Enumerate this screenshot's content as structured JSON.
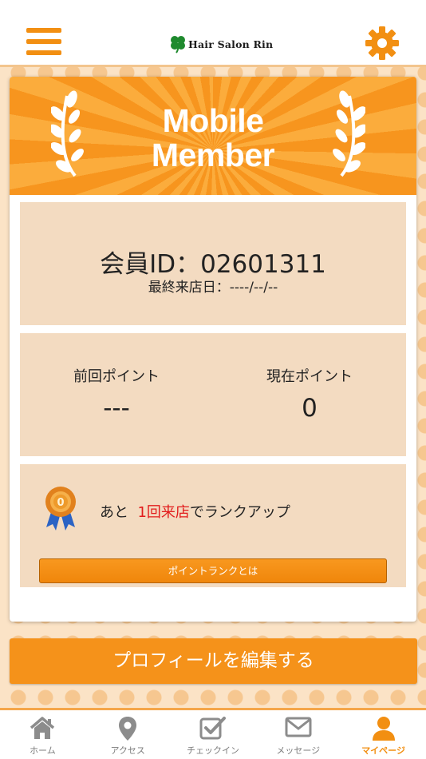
{
  "header": {
    "brand_name": "Hair Salon Rin",
    "menu_icon": "hamburger-menu-icon",
    "settings_icon": "gear-icon",
    "accent_color": "#f28f12"
  },
  "banner": {
    "line1": "Mobile",
    "line2": "Member"
  },
  "member": {
    "id_text": "会員ID：02601311",
    "last_visit_text": "最終来店日：----/--/--"
  },
  "points": {
    "previous_label": "前回ポイント",
    "previous_value": "---",
    "current_label": "現在ポイント",
    "current_value": "0"
  },
  "rank": {
    "prefix": "あと",
    "highlight": "1回来店",
    "suffix": "でランクアップ",
    "highlight_color": "#e21c1c",
    "button_label": "ポイントランクとは"
  },
  "edit_profile": {
    "label": "プロフィールを編集する"
  },
  "tabs": [
    {
      "label": "ホーム",
      "icon": "home-icon",
      "active": false
    },
    {
      "label": "アクセス",
      "icon": "map-pin-icon",
      "active": false
    },
    {
      "label": "チェックイン",
      "icon": "checkin-icon",
      "active": false
    },
    {
      "label": "メッセージ",
      "icon": "mail-icon",
      "active": false
    },
    {
      "label": "マイページ",
      "icon": "user-icon",
      "active": true
    }
  ]
}
